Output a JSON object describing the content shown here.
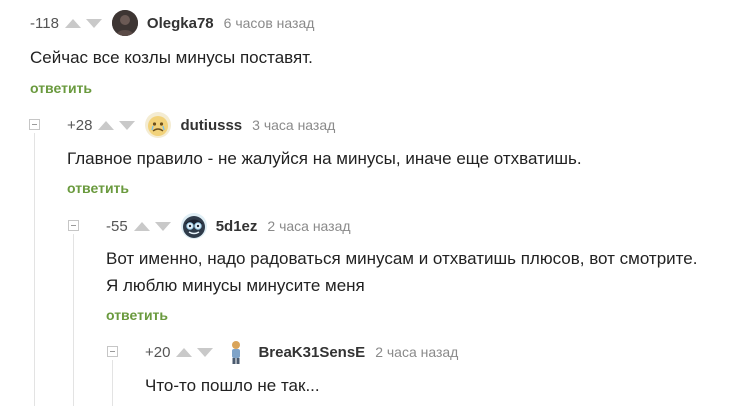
{
  "comments": [
    {
      "rating": "-118",
      "author": "Olegka78",
      "time": "6 часов назад",
      "text": "Сейчас все козлы минусы поставят.",
      "reply_label": "ответить",
      "avatar_icon": "dark-user-photo-icon"
    },
    {
      "rating": "+28",
      "author": "dutiusss",
      "time": "3 часа назад",
      "text": "Главное правило - не жалуйся на минусы, иначе еще отхватишь.",
      "reply_label": "ответить",
      "avatar_icon": "crying-cartoon-face-icon"
    },
    {
      "rating": "-55",
      "author": "5d1ez",
      "time": "2 часа назад",
      "text_line1": "Вот именно, надо радоваться минусам и отхватишь плюсов, вот смотрите.",
      "text_line2": "Я люблю минусы минусите меня",
      "reply_label": "ответить",
      "avatar_icon": "cartoon-face-with-glasses-icon"
    },
    {
      "rating": "+20",
      "author": "BreaK31SensE",
      "time": "2 часа назад",
      "text": "Что-то пошло не так...",
      "avatar_icon": "standing-figure-icon"
    }
  ],
  "colors": {
    "reply_link": "#6a9a3e",
    "vote_arrow": "#c9c9c9",
    "meta_text": "#8a8a8a"
  }
}
